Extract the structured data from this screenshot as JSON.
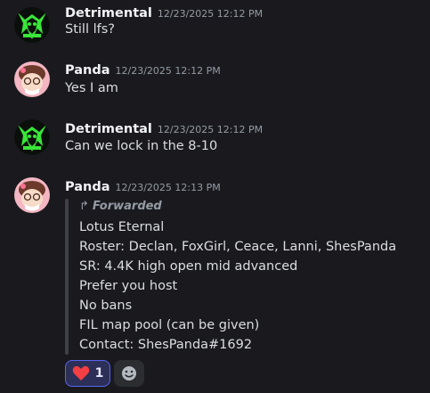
{
  "messages": [
    {
      "author": "Detrimental",
      "timestamp": "12/23/2025 12:12 PM",
      "text": "Still lfs?"
    },
    {
      "author": "Panda",
      "timestamp": "12/23/2025 12:12 PM",
      "text": "Yes I am"
    },
    {
      "author": "Detrimental",
      "timestamp": "12/23/2025 12:12 PM",
      "text": "Can we lock in the 8-10"
    },
    {
      "author": "Panda",
      "timestamp": "12/23/2025 12:13 PM",
      "forwarded_label": "Forwarded",
      "forwarded_lines": [
        "Lotus Eternal",
        "Roster: Declan, FoxGirl, Ceace, Lanni, ShesPanda",
        "SR: 4.4K high open  mid advanced",
        "Prefer you host",
        "No bans",
        "FIL map pool (can be given)",
        "Contact: ShesPanda#1692"
      ]
    }
  ],
  "reaction": {
    "emoji": "heart",
    "count": "1"
  },
  "icons": {
    "forward": "forward-arrow-icon",
    "add_reaction": "smiley-icon"
  },
  "colors": {
    "background": "#1a1a1e",
    "accent": "#5865f2",
    "heart": "#f23f43",
    "detrimental_avatar": "#22c55e"
  }
}
